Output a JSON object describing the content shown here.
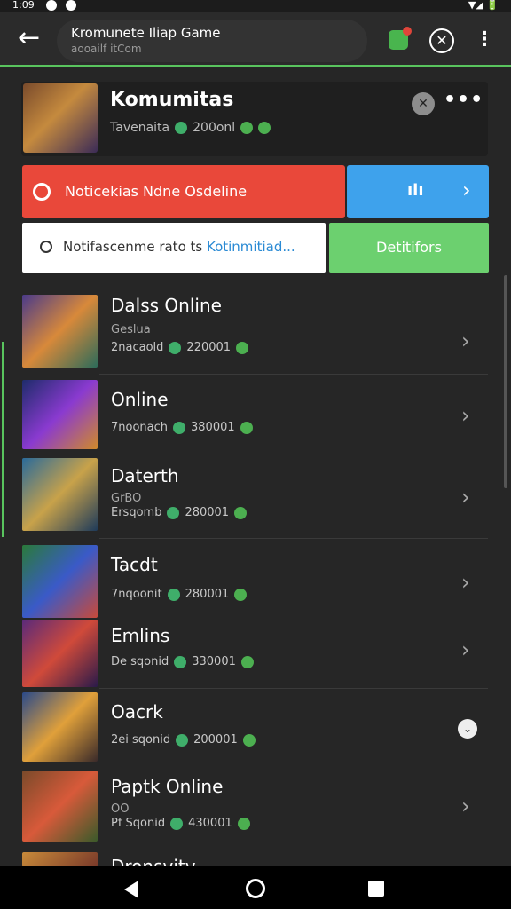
{
  "status": {
    "time": "1:09",
    "right": "▼◢ 🔋"
  },
  "appbar": {
    "title": "Kromunete Iliap Game",
    "subtitle": "aooailf itCom"
  },
  "header": {
    "title": "Komumitas",
    "subtitle": "Tavenaita",
    "count": "200onl"
  },
  "red_bar": {
    "label": "Noticekias Ndne Osdeline"
  },
  "search": {
    "prefix": "Notifascenme rato ts ",
    "highlight": "Kotinmitiad..."
  },
  "green_button": {
    "label": "Detitifors"
  },
  "colors": {
    "accent_green": "#59c45e",
    "red": "#e9483a",
    "blue": "#3ea2ec",
    "button_green": "#6cd06f"
  },
  "items": [
    {
      "name": "Dalss Online",
      "sub": "Geslua",
      "meta_left": "2nacaold",
      "meta_value": "220001",
      "chevron": "›"
    },
    {
      "name": "Online",
      "sub": "",
      "meta_left": "7noonach",
      "meta_value": "380001",
      "chevron": "›"
    },
    {
      "name": "Daterth",
      "sub": "GrBO",
      "meta_left": "Ersqomb",
      "meta_value": "280001",
      "chevron": "›"
    },
    {
      "name": "Tacdt",
      "sub": "",
      "meta_left": "7nqoonit",
      "meta_value": "280001",
      "chevron": "›"
    },
    {
      "name": "Emlins",
      "sub": "",
      "meta_left": "De sqonid",
      "meta_value": "330001",
      "chevron": "›"
    },
    {
      "name": "Oacrk",
      "sub": "",
      "meta_left": "2ei sqonid",
      "meta_value": "200001",
      "chevron": "⌄"
    },
    {
      "name": "Paptk Online",
      "sub": "OO",
      "meta_left": "Pf Sqonid",
      "meta_value": "430001",
      "chevron": "›"
    },
    {
      "name": "Dronsvity",
      "sub": "",
      "meta_left": "",
      "meta_value": "",
      "chevron": ""
    }
  ]
}
